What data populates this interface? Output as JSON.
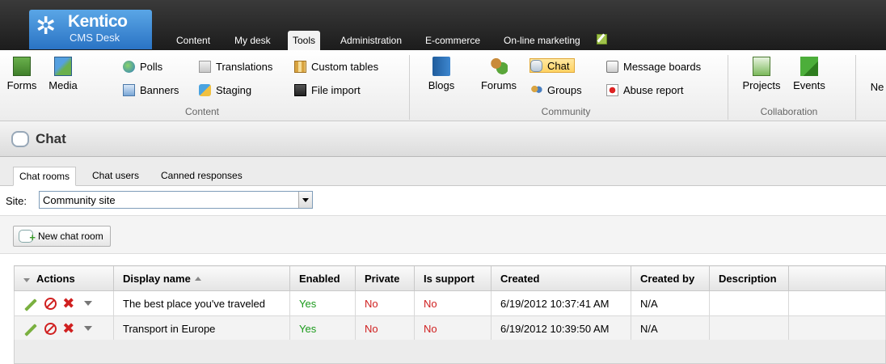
{
  "header": {
    "brand": "Kentico",
    "product": "CMS Desk",
    "tabs": [
      {
        "label": "Content"
      },
      {
        "label": "My desk"
      },
      {
        "label": "Tools"
      },
      {
        "label": "Administration"
      },
      {
        "label": "E-commerce"
      },
      {
        "label": "On-line marketing"
      }
    ]
  },
  "ribbon": {
    "forms": "Forms",
    "media": "Media",
    "polls": "Polls",
    "banners": "Banners",
    "translations": "Translations",
    "staging": "Staging",
    "custom_tables": "Custom tables",
    "file_import": "File import",
    "group_content": "Content",
    "blogs": "Blogs",
    "forums": "Forums",
    "chat": "Chat",
    "groups": "Groups",
    "message_boards": "Message boards",
    "abuse_report": "Abuse report",
    "group_community": "Community",
    "projects": "Projects",
    "events": "Events",
    "group_collaboration": "Collaboration",
    "cut_off": "Ne"
  },
  "page": {
    "title": "Chat"
  },
  "subtabs": [
    {
      "label": "Chat rooms"
    },
    {
      "label": "Chat users"
    },
    {
      "label": "Canned responses"
    }
  ],
  "site": {
    "label": "Site:",
    "value": "Community site"
  },
  "actions": {
    "new_chat_room": "New chat room"
  },
  "grid": {
    "headers": {
      "actions": "Actions",
      "display_name": "Display name",
      "enabled": "Enabled",
      "private": "Private",
      "is_support": "Is support",
      "created": "Created",
      "created_by": "Created by",
      "description": "Description"
    },
    "rows": [
      {
        "display_name": "The best place you've traveled",
        "enabled": "Yes",
        "private": "No",
        "is_support": "No",
        "created": "6/19/2012 10:37:41 AM",
        "created_by": "N/A",
        "description": ""
      },
      {
        "display_name": "Transport in Europe",
        "enabled": "Yes",
        "private": "No",
        "is_support": "No",
        "created": "6/19/2012 10:39:50 AM",
        "created_by": "N/A",
        "description": ""
      }
    ]
  }
}
